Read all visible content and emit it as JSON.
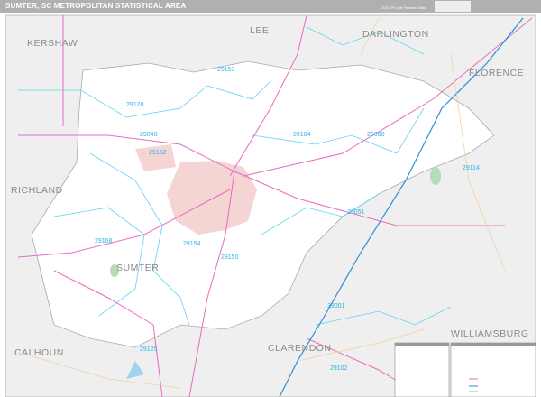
{
  "header": {
    "title": "SUMTER, SC METROPOLITAN STATISTICAL AREA",
    "edition": "2026 ZIP Code Premium Edition"
  },
  "counties": [
    "KERSHAW",
    "LEE",
    "DARLINGTON",
    "FLORENCE",
    "RICHLAND",
    "SUMTER",
    "CALHOUN",
    "CLARENDON",
    "WILLIAMSBURG"
  ],
  "zips": [
    "29153",
    "29128",
    "29040",
    "29104",
    "29080",
    "29114",
    "29152",
    "29051",
    "29168",
    "29154",
    "29150",
    "29001",
    "29125",
    "29102"
  ],
  "colors": {
    "msa": "#ffffff",
    "outside": "#efefef",
    "zip_boundary": "#5fd3f0",
    "highway": "#e86bc0",
    "interstate": "#2a8fd8",
    "urban": "#f2c9c9",
    "road": "#f5cfa0"
  }
}
